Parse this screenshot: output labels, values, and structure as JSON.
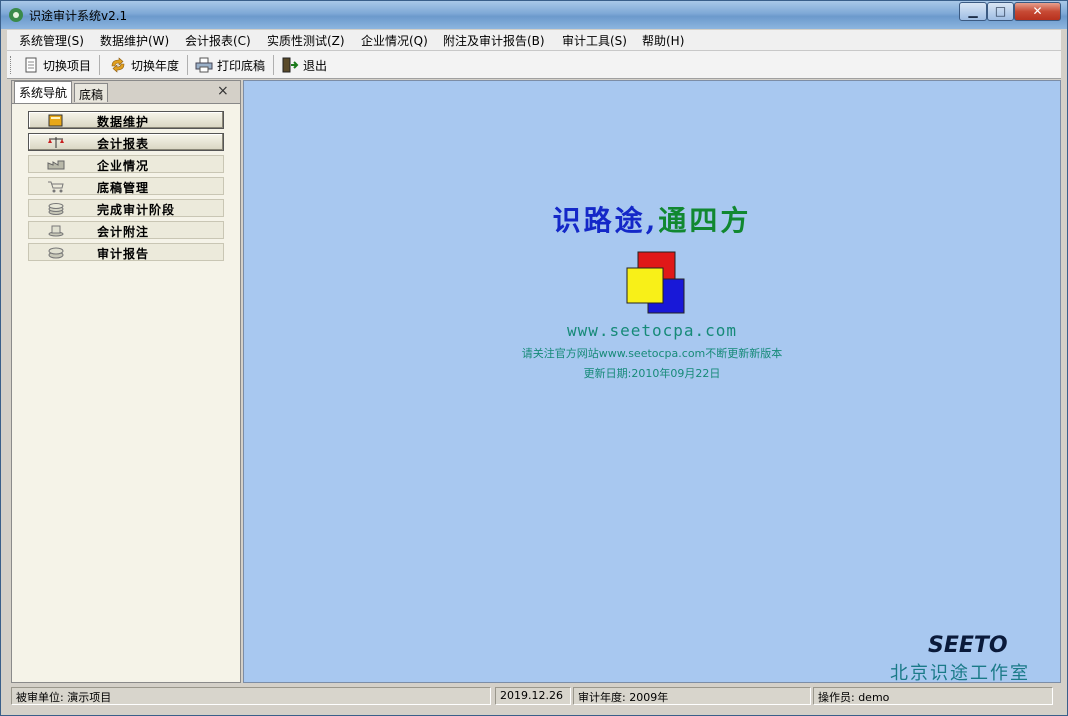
{
  "window": {
    "title": "识途审计系统v2.1"
  },
  "menu": [
    "系统管理(S)",
    "数据维护(W)",
    "会计报表(C)",
    "实质性测试(Z)",
    "企业情况(Q)",
    "附注及审计报告(B)",
    "审计工具(S)",
    "帮助(H)"
  ],
  "toolbar": {
    "switch_project": "切换项目",
    "switch_year": "切换年度",
    "print_drafts": "打印底稿",
    "exit": "退出"
  },
  "panel": {
    "tabs": [
      "系统导航",
      "底稿"
    ],
    "close_symbol": "×",
    "nav": [
      {
        "label": "数据维护",
        "icon": "folder-icon"
      },
      {
        "label": "会计报表",
        "icon": "scale-icon"
      },
      {
        "label": "企业情况",
        "icon": "factory-icon"
      },
      {
        "label": "底稿管理",
        "icon": "cart-icon"
      },
      {
        "label": "完成审计阶段",
        "icon": "coins-icon"
      },
      {
        "label": "会计附注",
        "icon": "notes-icon"
      },
      {
        "label": "审计报告",
        "icon": "report-icon"
      }
    ]
  },
  "splash": {
    "slogan_part1": "识路途,",
    "slogan_part2": "通四方",
    "url": "www.seetocpa.com",
    "notice": "请关注官方网站www.seetocpa.com不断更新新版本",
    "update": "更新日期:2010年09月22日",
    "brand_en": "SEETO",
    "brand_cn": "北京识途工作室"
  },
  "status": {
    "unit": "被审单位: 演示项目",
    "date": "2019.12.26",
    "year": "审计年度: 2009年",
    "operator": "操作员: demo"
  },
  "colors": {
    "main_bg": "#a8c8f0",
    "slogan_blue": "#1428c8",
    "slogan_green": "#118830",
    "url_teal": "#168a78"
  }
}
